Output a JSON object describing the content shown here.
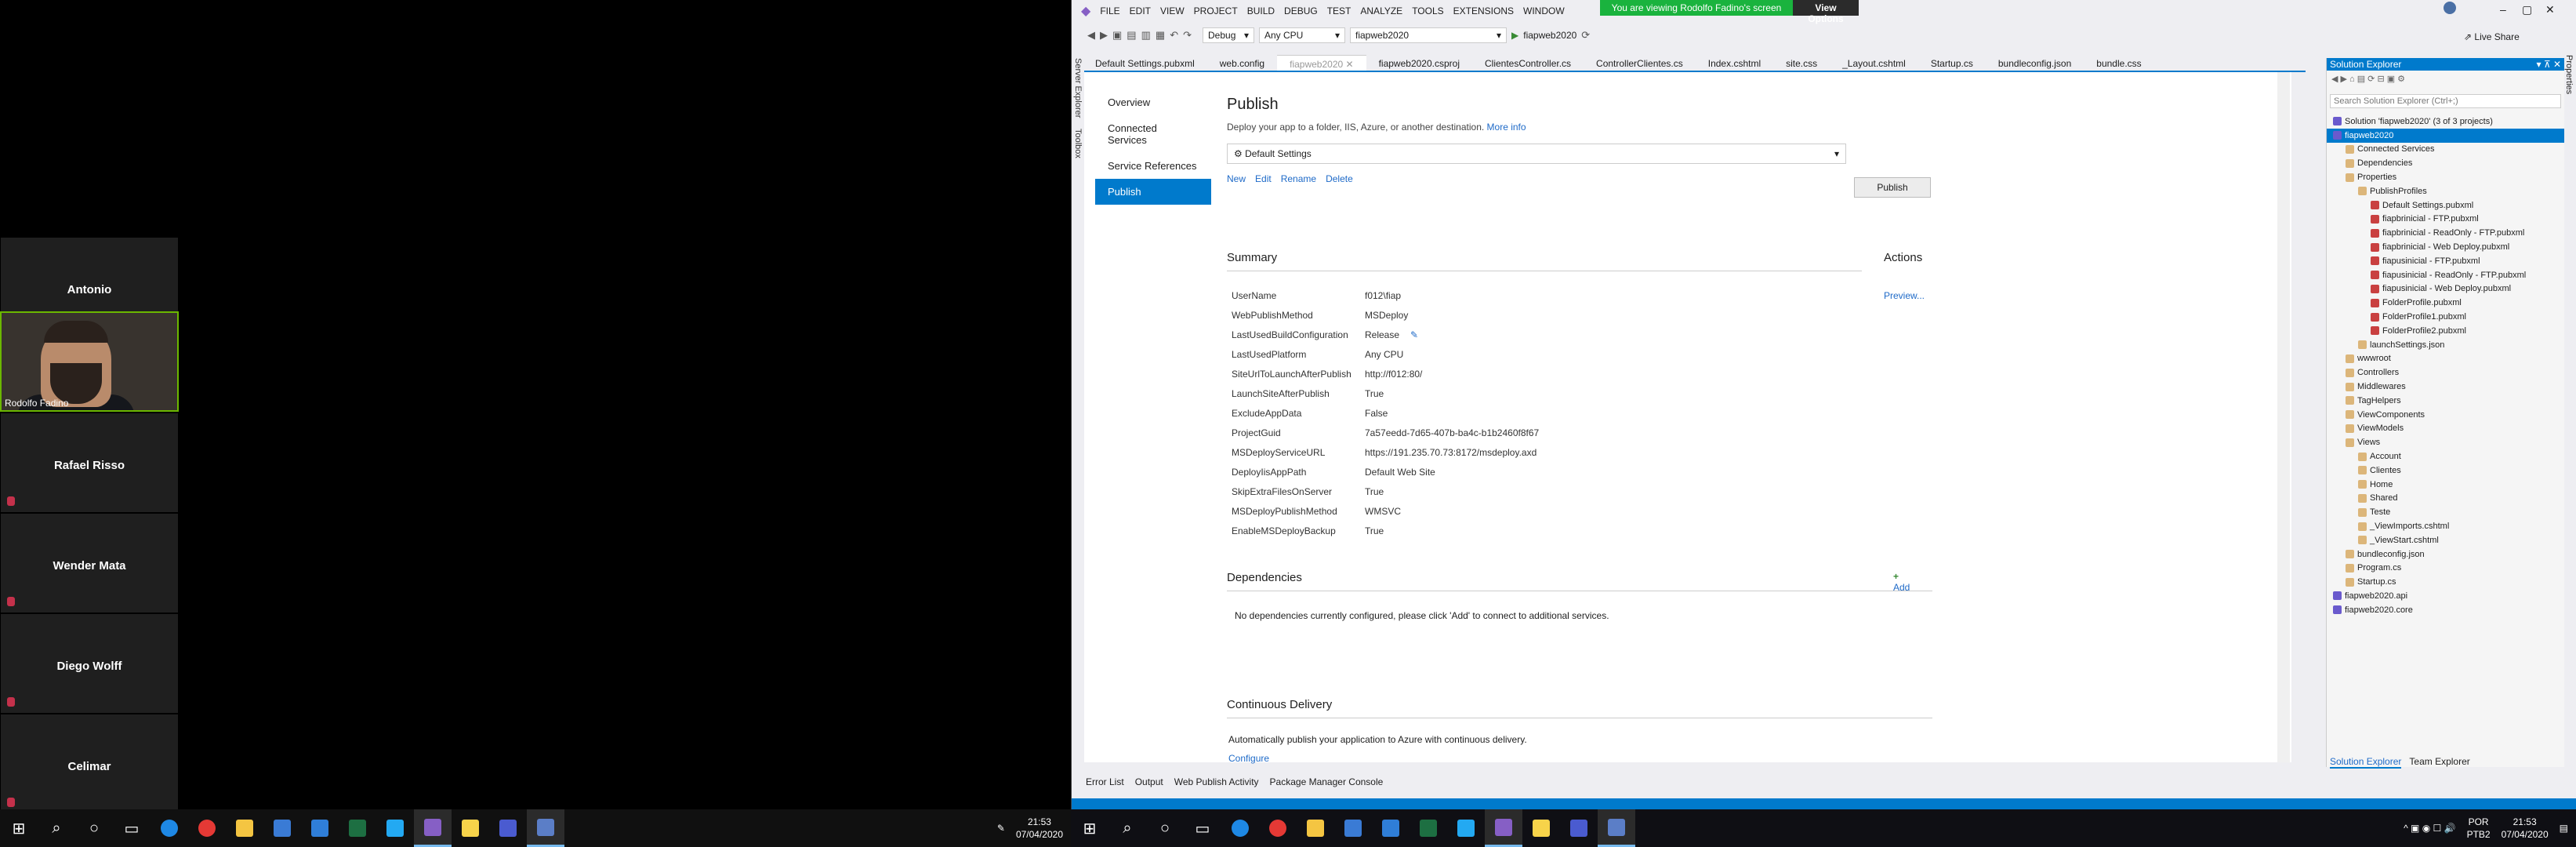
{
  "meeting": {
    "participants": [
      {
        "name": "Antonio"
      },
      {
        "name": "Rodolfo Fadino"
      },
      {
        "name": "Rafael Risso"
      },
      {
        "name": "Wender Mata"
      },
      {
        "name": "Diego Wolff"
      },
      {
        "name": "Celimar"
      }
    ]
  },
  "left_taskbar": {
    "clock_time": "21:53",
    "clock_date": "07/04/2020",
    "icons": [
      "windows-icon",
      "search-icon",
      "cortana-icon",
      "task-view-icon",
      "edge-icon",
      "chrome-icon",
      "explorer-icon",
      "store-icon",
      "mail-icon",
      "excel-icon",
      "vscode-icon",
      "visual-studio-icon",
      "sticky-notes-icon",
      "teams-icon",
      "remote-icon"
    ]
  },
  "vs": {
    "menu": [
      "FILE",
      "EDIT",
      "VIEW",
      "PROJECT",
      "BUILD",
      "DEBUG",
      "TEST",
      "ANALYZE",
      "TOOLS",
      "EXTENSIONS",
      "WINDOW"
    ],
    "banner_text": "You are viewing Rodolfo Fadino's screen",
    "view_options": "View Options",
    "live_share": "Live Share",
    "toolbar": {
      "config": "Debug",
      "platform": "Any CPU",
      "startup": "fiapweb2020",
      "run": "fiapweb2020"
    },
    "tabs": [
      "Default Settings.pubxml",
      "web.config",
      "fiapweb2020",
      "fiapweb2020.csproj",
      "ClientesController.cs",
      "ControllerClientes.cs",
      "Index.cshtml",
      "site.css",
      "_Layout.cshtml",
      "Startup.cs",
      "bundleconfig.json",
      "bundle.css"
    ],
    "active_tab_index": 2,
    "side_panels": [
      "Server Explorer",
      "Toolbox"
    ],
    "right_side_panel": "Properties",
    "publish": {
      "nav": [
        "Overview",
        "Connected Services",
        "Service References",
        "Publish"
      ],
      "selected_nav": 3,
      "title": "Publish",
      "subtitle": "Deploy your app to a folder, IIS, Azure, or another destination.",
      "more_info": "More info",
      "profile": "Default Settings",
      "publish_button": "Publish",
      "profile_actions": [
        "New",
        "Edit",
        "Rename",
        "Delete"
      ],
      "summary_title": "Summary",
      "actions_title": "Actions",
      "preview_link": "Preview...",
      "summary": [
        {
          "k": "UserName",
          "v": "f012\\fiap"
        },
        {
          "k": "WebPublishMethod",
          "v": "MSDeploy"
        },
        {
          "k": "LastUsedBuildConfiguration",
          "v": "Release"
        },
        {
          "k": "LastUsedPlatform",
          "v": "Any CPU"
        },
        {
          "k": "SiteUrlToLaunchAfterPublish",
          "v": "http://f012:80/"
        },
        {
          "k": "LaunchSiteAfterPublish",
          "v": "True"
        },
        {
          "k": "ExcludeAppData",
          "v": "False"
        },
        {
          "k": "ProjectGuid",
          "v": "7a57eedd-7d65-407b-ba4c-b1b2460f8f67"
        },
        {
          "k": "MSDeployServiceURL",
          "v": "https://191.235.70.73:8172/msdeploy.axd"
        },
        {
          "k": "DeployIisAppPath",
          "v": "Default Web Site"
        },
        {
          "k": "SkipExtraFilesOnServer",
          "v": "True"
        },
        {
          "k": "MSDeployPublishMethod",
          "v": "WMSVC"
        },
        {
          "k": "EnableMSDeployBackup",
          "v": "True"
        }
      ],
      "dependencies_title": "Dependencies",
      "add_label": "Add",
      "dependencies_text": "No dependencies currently configured, please click 'Add' to connect to additional services.",
      "cd_title": "Continuous Delivery",
      "cd_text": "Automatically publish your application to Azure with continuous delivery.",
      "configure": "Configure"
    },
    "bottom_tabs": [
      "Error List",
      "Output",
      "Web Publish Activity",
      "Package Manager Console"
    ],
    "solution_explorer": {
      "title": "Solution Explorer",
      "search_placeholder": "Search Solution Explorer (Ctrl+;)",
      "tree": [
        {
          "t": "Solution 'fiapweb2020' (3 of 3 projects)",
          "d": 0
        },
        {
          "t": "fiapweb2020",
          "d": 0,
          "sel": true
        },
        {
          "t": "Connected Services",
          "d": 1
        },
        {
          "t": "Dependencies",
          "d": 1
        },
        {
          "t": "Properties",
          "d": 1
        },
        {
          "t": "PublishProfiles",
          "d": 2
        },
        {
          "t": "Default Settings.pubxml",
          "d": 3
        },
        {
          "t": "fiapbrinicial - FTP.pubxml",
          "d": 3
        },
        {
          "t": "fiapbrinicial - ReadOnly - FTP.pubxml",
          "d": 3
        },
        {
          "t": "fiapbrinicial - Web Deploy.pubxml",
          "d": 3
        },
        {
          "t": "fiapusinicial - FTP.pubxml",
          "d": 3
        },
        {
          "t": "fiapusinicial - ReadOnly - FTP.pubxml",
          "d": 3
        },
        {
          "t": "fiapusinicial - Web Deploy.pubxml",
          "d": 3
        },
        {
          "t": "FolderProfile.pubxml",
          "d": 3
        },
        {
          "t": "FolderProfile1.pubxml",
          "d": 3
        },
        {
          "t": "FolderProfile2.pubxml",
          "d": 3
        },
        {
          "t": "launchSettings.json",
          "d": 2
        },
        {
          "t": "wwwroot",
          "d": 1
        },
        {
          "t": "Controllers",
          "d": 1
        },
        {
          "t": "Middlewares",
          "d": 1
        },
        {
          "t": "TagHelpers",
          "d": 1
        },
        {
          "t": "ViewComponents",
          "d": 1
        },
        {
          "t": "ViewModels",
          "d": 1
        },
        {
          "t": "Views",
          "d": 1
        },
        {
          "t": "Account",
          "d": 2
        },
        {
          "t": "Clientes",
          "d": 2
        },
        {
          "t": "Home",
          "d": 2
        },
        {
          "t": "Shared",
          "d": 2
        },
        {
          "t": "Teste",
          "d": 2
        },
        {
          "t": "_ViewImports.cshtml",
          "d": 2
        },
        {
          "t": "_ViewStart.cshtml",
          "d": 2
        },
        {
          "t": "bundleconfig.json",
          "d": 1
        },
        {
          "t": "Program.cs",
          "d": 1
        },
        {
          "t": "Startup.cs",
          "d": 1
        },
        {
          "t": "fiapweb2020.api",
          "d": 0
        },
        {
          "t": "fiapweb2020.core",
          "d": 0
        }
      ],
      "footer_tabs": [
        "Solution Explorer",
        "Team Explorer"
      ]
    }
  },
  "right_taskbar": {
    "lang": "POR",
    "kbd": "PTB2",
    "time": "21:53",
    "date": "07/04/2020"
  }
}
